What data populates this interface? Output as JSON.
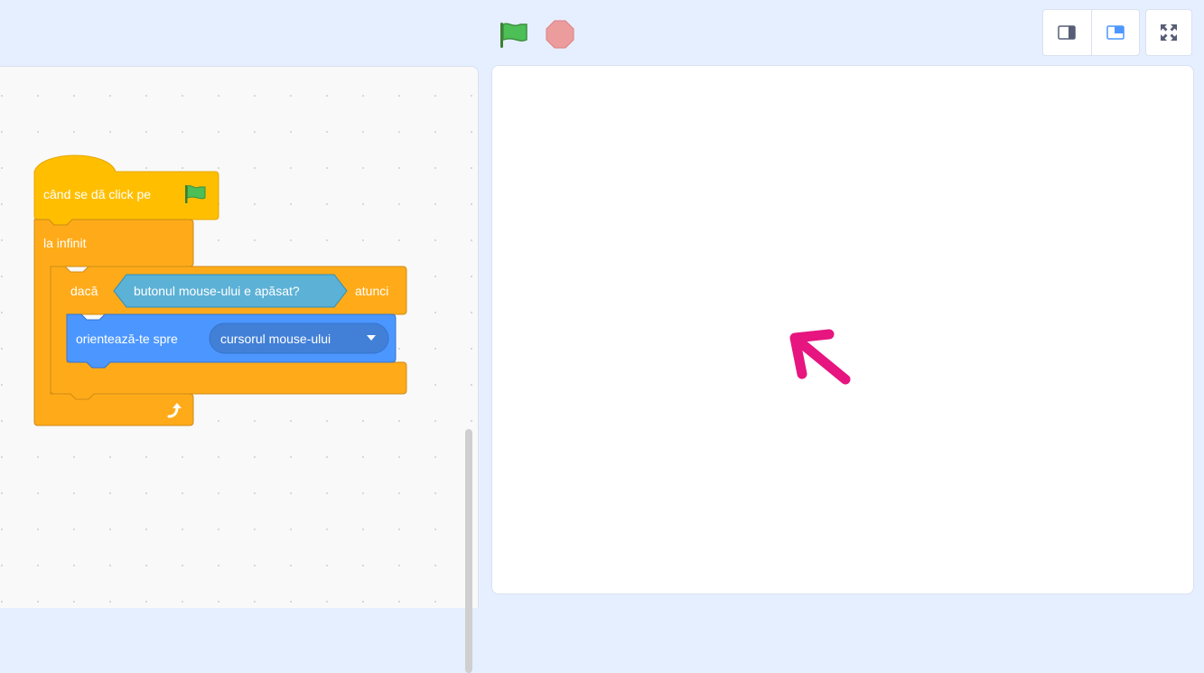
{
  "controls": {
    "green_flag_icon": "green-flag-icon",
    "stop_icon": "stop-icon",
    "layout_buttons": [
      "small-stage-layout-icon",
      "normal-stage-layout-icon"
    ],
    "fullscreen_icon": "fullscreen-icon"
  },
  "script": {
    "hat_label": "când se dă click pe",
    "forever_label": "la infinit",
    "if_label": "dacă",
    "condition_label": "butonul mouse-ului e apăsat?",
    "then_label": "atunci",
    "point_label": "orientează-te spre",
    "target_value": "cursorul mouse-ului"
  },
  "colors": {
    "events": "#ffbf00",
    "control": "#ffab19",
    "sensing": "#5cb1d6",
    "motion": "#4c97ff",
    "sprite": "#e6157f"
  },
  "stage": {
    "sprite": "arrow-sprite"
  }
}
